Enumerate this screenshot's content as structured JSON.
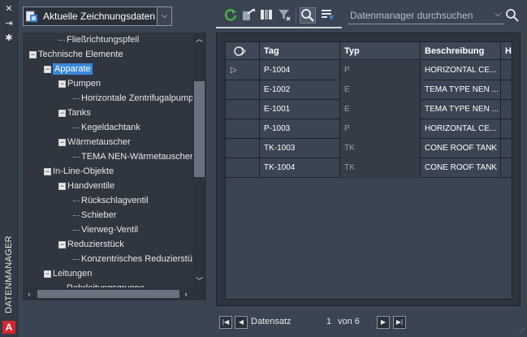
{
  "palette": {
    "title": "DATENMANAGER",
    "logo": "A"
  },
  "selector": {
    "value": "Aktuelle Zeichnungsdaten"
  },
  "tree": {
    "items": [
      {
        "label": "Fließrichtungspfeil",
        "level": 2,
        "expander": "",
        "selected": false
      },
      {
        "label": "Technische Elemente",
        "level": 0,
        "expander": "−",
        "selected": false
      },
      {
        "label": "Apparate",
        "level": 1,
        "expander": "−",
        "selected": true
      },
      {
        "label": "Pumpen",
        "level": 2,
        "expander": "−",
        "selected": false
      },
      {
        "label": "Horizontale Zentrifugalpumpe",
        "level": 3,
        "expander": "",
        "selected": false
      },
      {
        "label": "Tanks",
        "level": 2,
        "expander": "−",
        "selected": false
      },
      {
        "label": "Kegeldachtank",
        "level": 3,
        "expander": "",
        "selected": false
      },
      {
        "label": "Wärmetauscher",
        "level": 2,
        "expander": "−",
        "selected": false
      },
      {
        "label": "TEMA NEN-Wärmetauscher",
        "level": 3,
        "expander": "",
        "selected": false
      },
      {
        "label": "In-Line-Objekte",
        "level": 1,
        "expander": "−",
        "selected": false
      },
      {
        "label": "Handventile",
        "level": 2,
        "expander": "−",
        "selected": false
      },
      {
        "label": "Rückschlagventil",
        "level": 3,
        "expander": "",
        "selected": false
      },
      {
        "label": "Schieber",
        "level": 3,
        "expander": "",
        "selected": false
      },
      {
        "label": "Vierweg-Ventil",
        "level": 3,
        "expander": "",
        "selected": false
      },
      {
        "label": "Reduzierstück",
        "level": 2,
        "expander": "−",
        "selected": false
      },
      {
        "label": "Konzentrisches Reduzierstück",
        "level": 3,
        "expander": "",
        "selected": false
      },
      {
        "label": "Leitungen",
        "level": 1,
        "expander": "−",
        "selected": false
      },
      {
        "label": "Rohrleitungsgruppe",
        "level": 2,
        "expander": "",
        "selected": false
      }
    ]
  },
  "search": {
    "placeholder": "Datenmanager durchsuchen"
  },
  "grid": {
    "columns": [
      "",
      "Tag",
      "Typ",
      "Beschreibung",
      "H"
    ],
    "rows": [
      {
        "marker": "▷",
        "tag": "P-1004",
        "typ": "P",
        "beschreibung": "HORIZONTAL CE..."
      },
      {
        "marker": "",
        "tag": "E-1002",
        "typ": "E",
        "beschreibung": "TEMA TYPE NEN ..."
      },
      {
        "marker": "",
        "tag": "E-1001",
        "typ": "E",
        "beschreibung": "TEMA TYPE NEN ..."
      },
      {
        "marker": "",
        "tag": "P-1003",
        "typ": "P",
        "beschreibung": "HORIZONTAL CE..."
      },
      {
        "marker": "",
        "tag": "TK-1003",
        "typ": "TK",
        "beschreibung": "CONE ROOF TANK"
      },
      {
        "marker": "",
        "tag": "TK-1004",
        "typ": "TK",
        "beschreibung": "CONE ROOF TANK"
      }
    ]
  },
  "pager": {
    "label": "Datensatz",
    "current": "1",
    "of_text": "von 6"
  },
  "icons": {
    "refresh": "refresh-icon",
    "accent": "#3a86d6",
    "green": "#44b24a"
  }
}
